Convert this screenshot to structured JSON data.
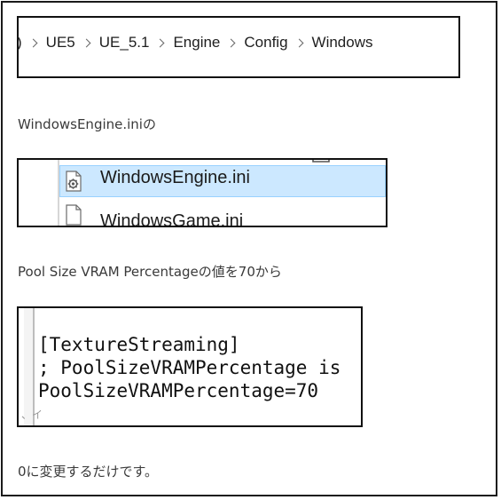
{
  "breadcrumb": {
    "leading_chevron": ")",
    "items": [
      "UE5",
      "UE_5.1",
      "Engine",
      "Config",
      "Windows"
    ]
  },
  "captions": {
    "ini_file": "WindowsEngine.iniの",
    "pool_size": "Pool Size VRAM Percentageの値を70から",
    "change_to": "0に変更するだけです。"
  },
  "file_list": {
    "selected_file": "WindowsEngine.ini",
    "next_file_partial": "WindowsGame.ini"
  },
  "code": {
    "lines": [
      "[TextureStreaming]",
      "; PoolSizeVRAMPercentage is",
      "PoolSizeVRAMPercentage=70"
    ],
    "bottom_mark": "、イ"
  }
}
